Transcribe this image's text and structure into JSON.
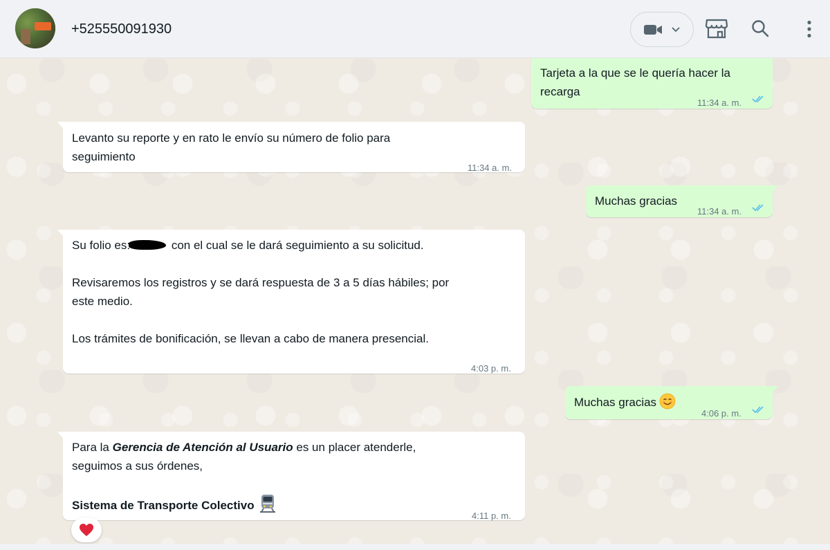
{
  "header": {
    "contact_name": "+525550091930",
    "avatar_icon": "contact-avatar",
    "video_icon": "video-camera-icon",
    "shop_icon": "storefront-icon",
    "search_icon": "search-icon",
    "menu_icon": "kebab-menu-icon"
  },
  "messages": [
    {
      "direction": "out",
      "text": "Tarjeta a la que se le quería hacer la\nrecarga",
      "time": "11:34 a. m.",
      "status": "read"
    },
    {
      "direction": "in",
      "text": "Levanto su reporte y en rato le envío su número de folio para\nseguimiento",
      "time": "11:34 a. m."
    },
    {
      "direction": "out",
      "text": "Muchas gracias",
      "time": "11:34 a. m.",
      "status": "read"
    },
    {
      "direction": "in",
      "text_a": "Su folio es:",
      "text_b": " con el cual se le dará seguimiento a su solicitud.",
      "text_c": "Revisaremos los registros y se dará respuesta de 3 a 5 días hábiles; por\neste medio.",
      "text_d": "Los trámites de bonificación, se llevan a cabo de manera presencial.",
      "time": "4:03 p. m."
    },
    {
      "direction": "out",
      "text": "Muchas gracias",
      "emoji": "smiling-face-emoji",
      "time": "4:06 p. m.",
      "status": "read"
    },
    {
      "direction": "in",
      "text_a": "Para la ",
      "text_bold": "Gerencia de Atención al Usuario",
      "text_b": " es un placer atenderle,\nseguimos a sus órdenes,",
      "signature": "Sistema de Transporte Colectivo",
      "emoji": "metro-train-emoji",
      "time": "4:11 p. m.",
      "reaction": "red-heart"
    }
  ],
  "colors": {
    "header_bg": "#f0f2f5",
    "chat_bg": "#efeae2",
    "incoming_bubble": "#ffffff",
    "outgoing_bubble": "#d9fdd3",
    "read_ticks": "#53bdeb",
    "timestamp": "#667781"
  }
}
